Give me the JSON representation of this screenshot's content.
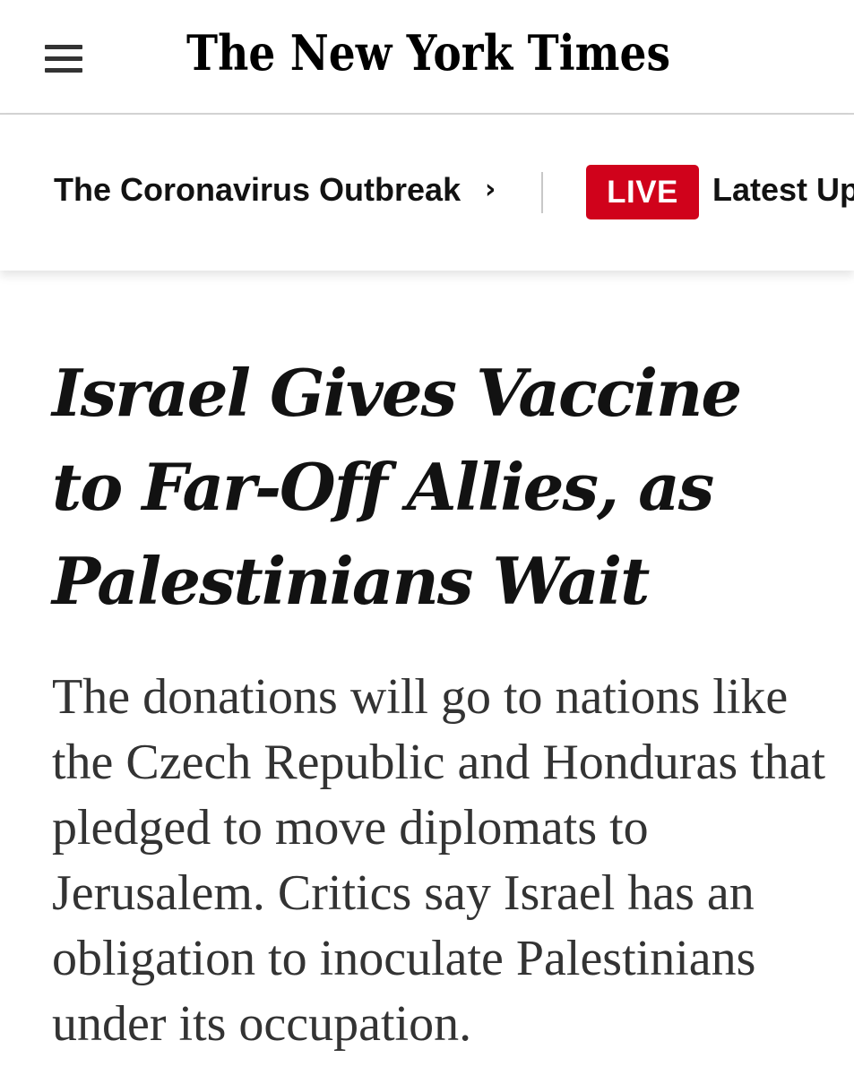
{
  "masthead": {
    "menu_icon": "hamburger-menu-icon",
    "logo_text": "The New York Times"
  },
  "section_bar": {
    "section_label": "The Coronavirus Outbreak",
    "chevron": "›",
    "live_badge": "LIVE",
    "latest_label": "Latest Up",
    "live_color": "#d0021b"
  },
  "article": {
    "headline": "Israel Gives Vaccine to Far-Off Allies, as Palestinians Wait",
    "summary": "The donations will go to nations like the Czech Republic and Honduras that pledged to move diplomats to Jerusalem. Critics say Israel has an obligation to inoculate Palestinians under its occupation."
  }
}
